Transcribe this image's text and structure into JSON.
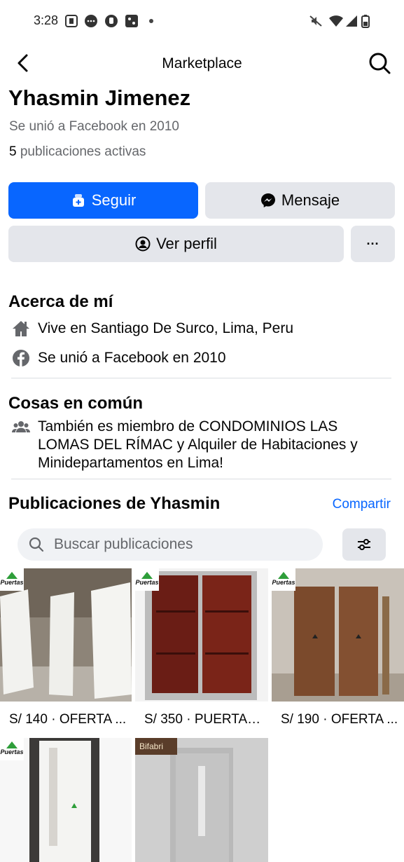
{
  "status": {
    "time": "3:28"
  },
  "nav": {
    "title": "Marketplace"
  },
  "profile": {
    "name": "Yhasmin Jimenez",
    "joined": "Se unió a Facebook en 2010",
    "active_count": "5",
    "active_label": "publicaciones activas"
  },
  "actions": {
    "follow": "Seguir",
    "message": "Mensaje",
    "view_profile": "Ver perfil",
    "more": "···"
  },
  "about": {
    "title": "Acerca de mí",
    "lives_prefix": "Vive en",
    "lives_place": "Santiago De Surco, Lima, Peru",
    "joined": "Se unió a Facebook en 2010"
  },
  "common": {
    "title": "Cosas en común",
    "prefix": "También es miembro de",
    "group1": "CONDOMINIOS LAS LOMAS DEL RÍMAC",
    "joiner": "y",
    "group2": "Alquiler de Habitaciones y Minidepartamentos en Lima!"
  },
  "listings_section": {
    "title": "Publicaciones de Yhasmin",
    "share": "Compartir",
    "search_placeholder": "Buscar publicaciones"
  },
  "listings": [
    {
      "price_text": "S/ 140 · OFERTA ...",
      "brand": "Puertas"
    },
    {
      "price_text": "S/ 350 · PUERTAS ...",
      "brand": "Puertas"
    },
    {
      "price_text": "S/ 190 · OFERTA ...",
      "brand": "Puertas"
    },
    {
      "price_text": "",
      "brand": "Puertas"
    },
    {
      "price_text": "",
      "brand": "Bifabri"
    }
  ],
  "colors": {
    "accent": "#0866ff",
    "secondary_button": "#e4e6eb",
    "muted_text": "#65676b"
  },
  "icons": [
    "chevron-left-icon",
    "search-icon",
    "follow-icon",
    "messenger-icon",
    "user-circle-icon",
    "home-icon",
    "facebook-icon",
    "group-icon",
    "filter-icon"
  ]
}
